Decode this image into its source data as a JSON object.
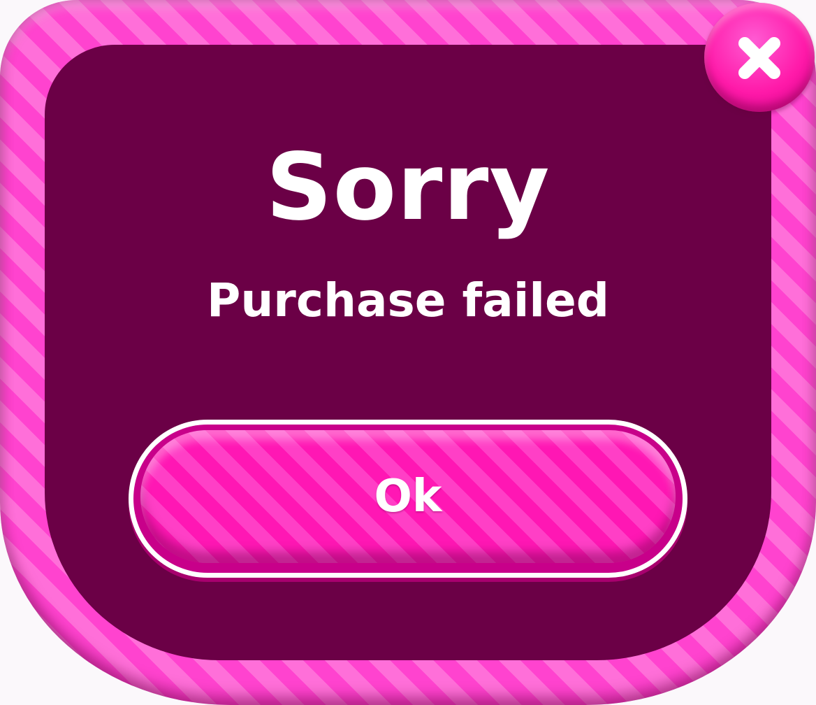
{
  "dialog": {
    "title": "Sorry",
    "message": "Purchase failed",
    "ok_label": "Ok",
    "close_icon": "close-icon"
  },
  "colors": {
    "frame_pink": "#ff43cf",
    "frame_pink_light": "#ff6fd9",
    "panel_plum": "#6b0046",
    "button_pink": "#ff17b4",
    "text_white": "#ffffff"
  }
}
